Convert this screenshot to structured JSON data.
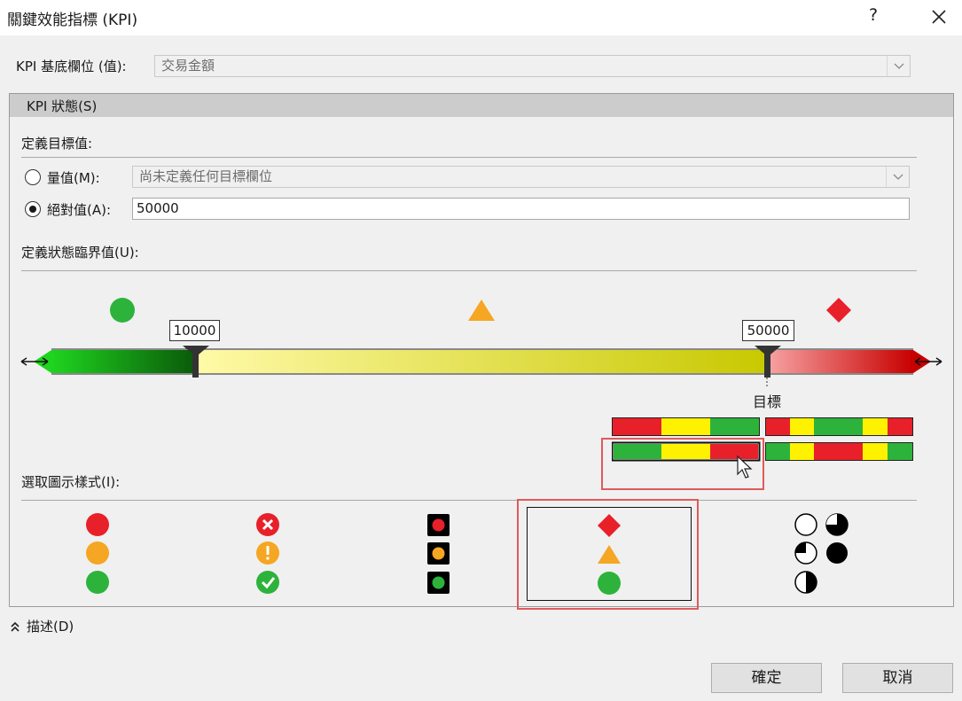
{
  "window": {
    "title": "關鍵效能指標 (KPI)",
    "help_label": "?"
  },
  "base_field": {
    "label": "KPI 基底欄位 (值):",
    "value": "交易金額"
  },
  "status_section": {
    "header": "KPI 狀態(S)",
    "define_target_label": "定義目標值:",
    "measure_option": {
      "label": "量值(M):",
      "value": "尚未定義任何目標欄位",
      "selected": false
    },
    "absolute_option": {
      "label": "絕對值(A):",
      "value": "50000",
      "selected": true
    },
    "thresholds_label": "定義狀態臨界值(U):",
    "thresholds": {
      "low": "10000",
      "high": "50000",
      "target_label": "目標",
      "zone_icons": [
        "green-circle",
        "orange-triangle",
        "red-diamond"
      ]
    },
    "threshold_gradient_presets": [
      {
        "name": "red-yellow-green",
        "selected": false
      },
      {
        "name": "red-yellow-green-yellow-red",
        "selected": false
      },
      {
        "name": "green-yellow-red",
        "selected": true
      },
      {
        "name": "green-yellow-red-yellow-green",
        "selected": false
      }
    ],
    "icon_style_label": "選取圖示樣式(I):",
    "icon_styles": [
      {
        "name": "circles",
        "selected": false
      },
      {
        "name": "symbols",
        "selected": false
      },
      {
        "name": "traffic-lights",
        "selected": false
      },
      {
        "name": "shapes",
        "selected": true
      },
      {
        "name": "pies",
        "selected": false
      }
    ]
  },
  "description_toggle": "描述(D)",
  "buttons": {
    "ok": "確定",
    "cancel": "取消"
  },
  "colors": {
    "green": "#2db33b",
    "orange": "#f5a623",
    "red": "#e8202a",
    "yellow": "#fff200",
    "selection_outline": "#e05a5a"
  }
}
